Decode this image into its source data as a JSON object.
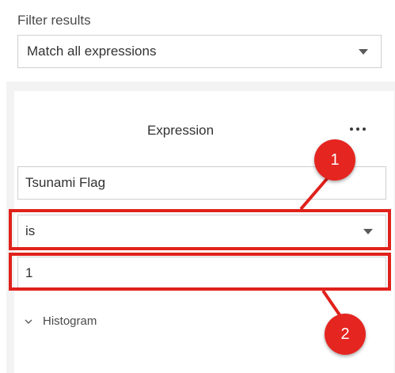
{
  "filter": {
    "label": "Filter results",
    "match_value": "Match all expressions"
  },
  "expression": {
    "title": "Expression",
    "field_value": "Tsunami Flag",
    "operator_value": "is",
    "input_value": "1",
    "histogram_label": "Histogram"
  },
  "callouts": {
    "one": "1",
    "two": "2"
  },
  "colors": {
    "highlight": "#e0211b",
    "callout": "#e52520"
  },
  "icons": {
    "more": "ellipsis-icon",
    "dropdown": "caret-down-icon",
    "expand": "chevron-down-icon"
  }
}
